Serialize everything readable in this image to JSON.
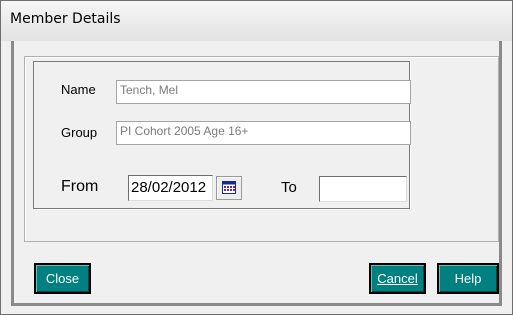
{
  "window": {
    "title": "Member Details"
  },
  "form": {
    "name_label": "Name",
    "name_value": "Tench, Mel",
    "group_label": "Group",
    "group_value": "PI Cohort 2005 Age 16+",
    "from_label": "From",
    "from_value": "28/02/2012",
    "to_label": "To",
    "to_value": "",
    "calendar_icon": "calendar-icon"
  },
  "buttons": {
    "close_label": "Close",
    "cancel_label": "Cancel",
    "help_label": "Help"
  },
  "colors": {
    "button_bg": "#008080",
    "button_text": "#ffffff"
  }
}
